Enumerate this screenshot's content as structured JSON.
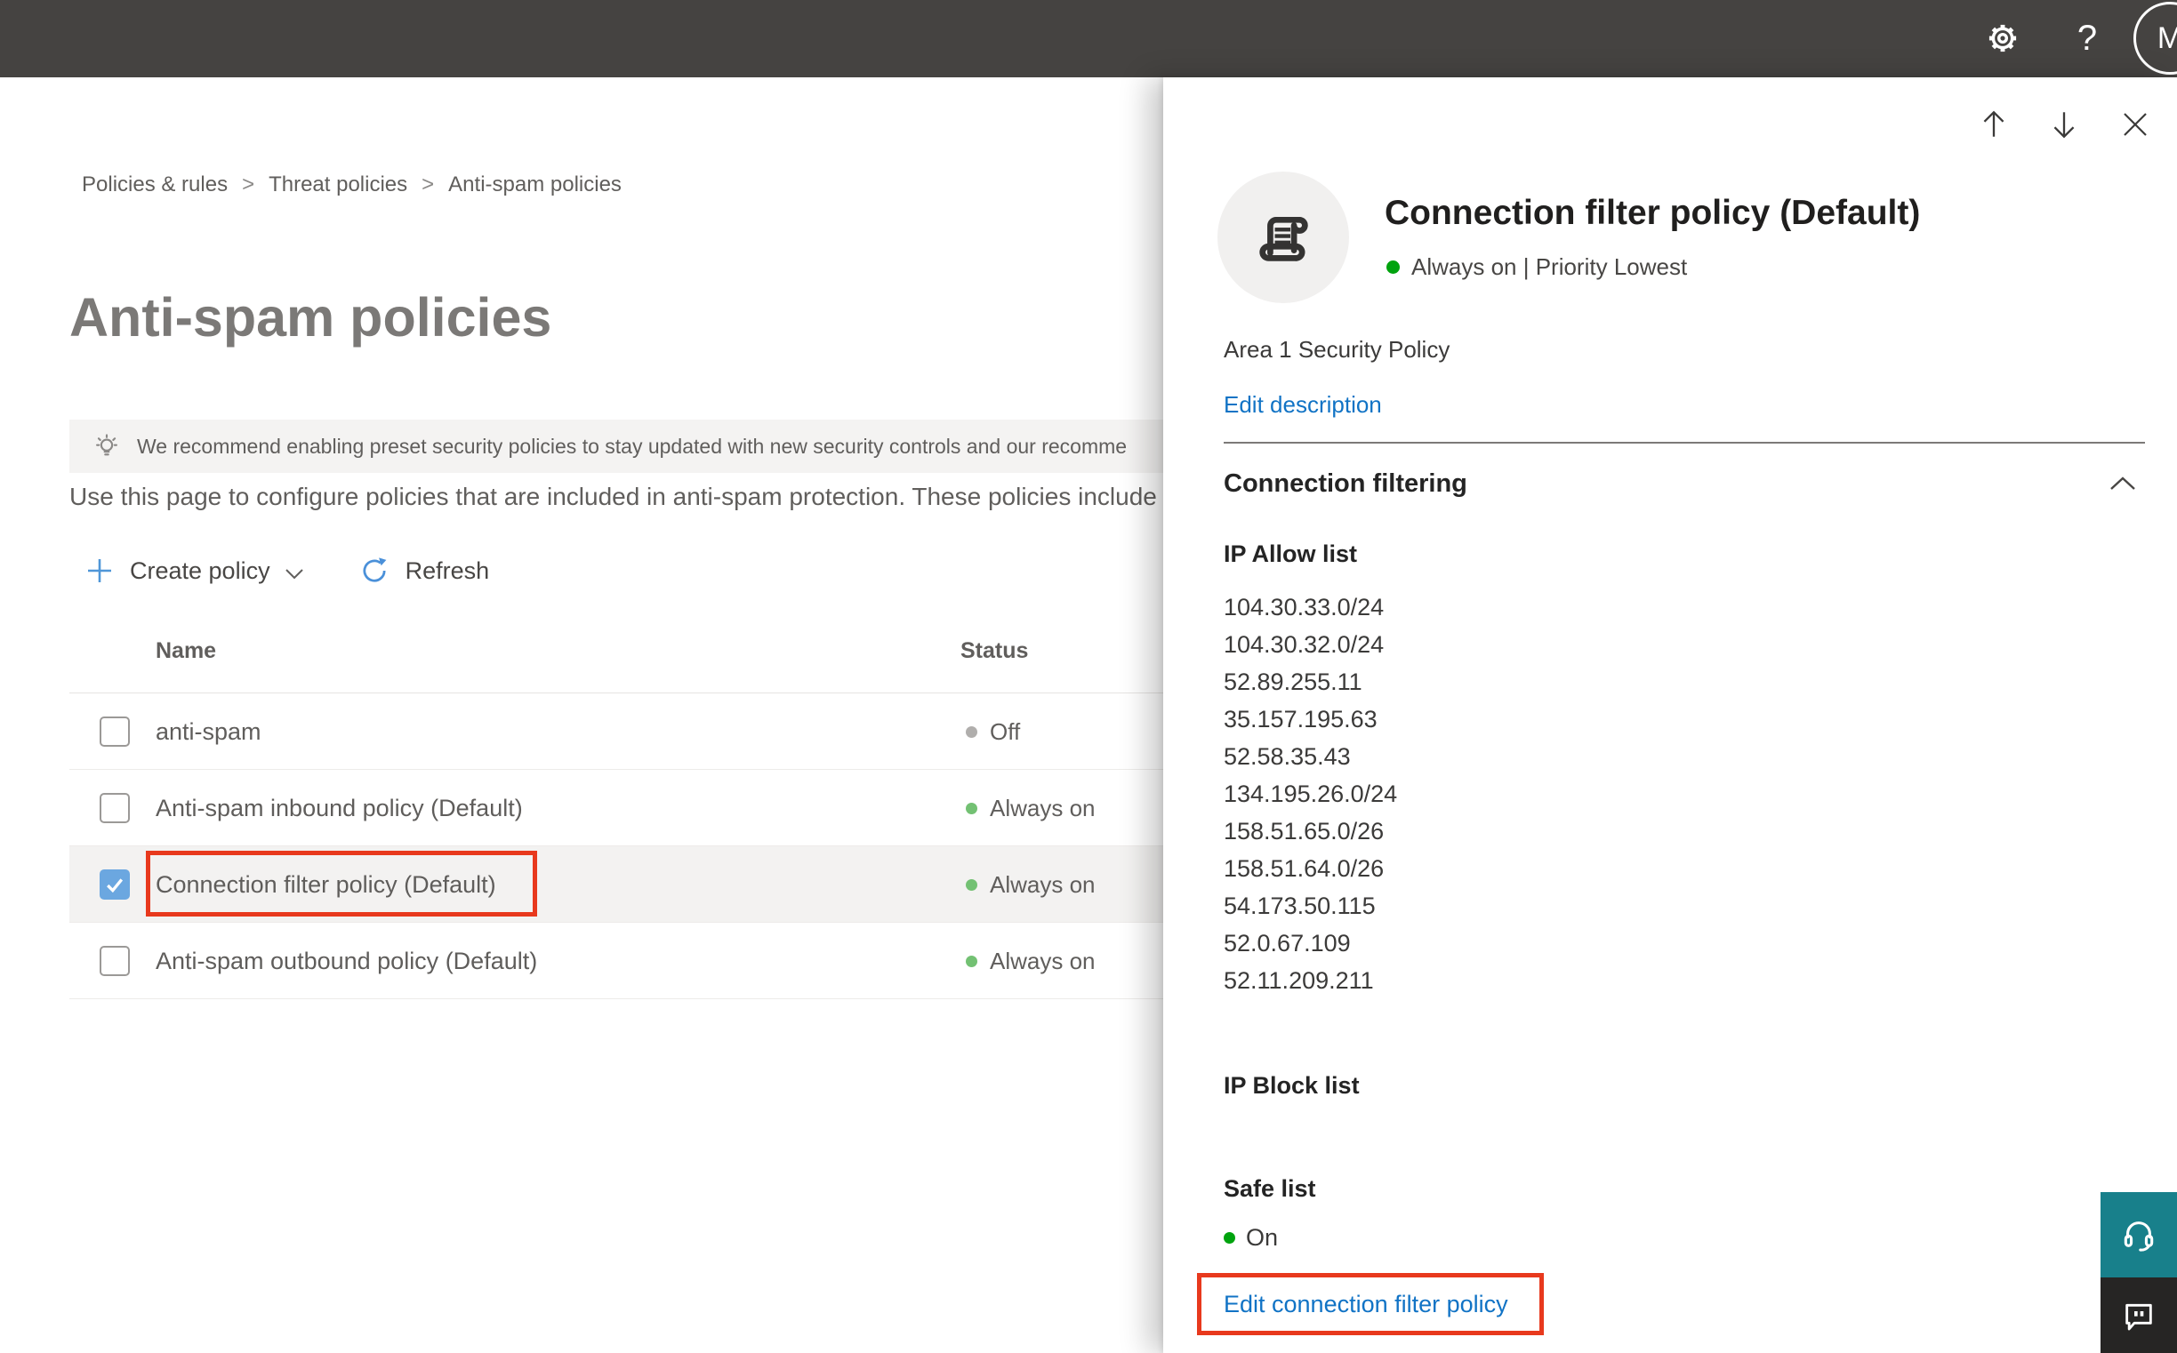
{
  "topbar": {
    "icons": [
      "gear-icon",
      "help-icon",
      "avatar"
    ],
    "help_glyph": "?",
    "avatar_initial": "M"
  },
  "breadcrumb": {
    "items": [
      "Policies & rules",
      "Threat policies",
      "Anti-spam policies"
    ],
    "separator": ">"
  },
  "page": {
    "title": "Anti-spam policies",
    "banner_text": "We recommend enabling preset security policies to stay updated with new security controls and our recomme",
    "description": "Use this page to configure policies that are included in anti-spam protection. These policies include"
  },
  "toolbar": {
    "create_label": "Create policy",
    "refresh_label": "Refresh"
  },
  "table": {
    "columns": [
      "Name",
      "Status"
    ],
    "rows": [
      {
        "name": "anti-spam",
        "status": "Off",
        "state": "off",
        "checked": false,
        "annotated": false
      },
      {
        "name": "Anti-spam inbound policy (Default)",
        "status": "Always on",
        "state": "on",
        "checked": false,
        "annotated": false
      },
      {
        "name": "Connection filter policy (Default)",
        "status": "Always on",
        "state": "on",
        "checked": true,
        "annotated": true
      },
      {
        "name": "Anti-spam outbound policy (Default)",
        "status": "Always on",
        "state": "on",
        "checked": false,
        "annotated": false
      }
    ]
  },
  "flyout": {
    "nav_icons": [
      "arrow-up-icon",
      "arrow-down-icon",
      "close-icon"
    ],
    "header_icon": "scroll-policy-icon",
    "title": "Connection filter policy (Default)",
    "status_line": "Always on | Priority Lowest",
    "description": "Area 1 Security Policy",
    "edit_description_label": "Edit description",
    "section_title": "Connection filtering",
    "ip_allow_title": "IP Allow list",
    "ip_allow_list": [
      "104.30.33.0/24",
      "104.30.32.0/24",
      "52.89.255.11",
      "35.157.195.63",
      "52.58.35.43",
      "134.195.26.0/24",
      "158.51.65.0/26",
      "158.51.64.0/26",
      "54.173.50.115",
      "52.0.67.109",
      "52.11.209.211"
    ],
    "ip_block_title": "IP Block list",
    "safe_list_title": "Safe list",
    "safe_list_status": "On",
    "edit_link_label": "Edit connection filter policy"
  },
  "corner_buttons": {
    "icons": [
      "headset-icon",
      "feedback-bubble-icon"
    ]
  },
  "colors": {
    "topbar_bg": "#454341",
    "accent_link": "#1173c5",
    "checkbox_checked": "#6ba7e0",
    "annotation_red": "#e8391d",
    "status_on_green": "#73c173",
    "status_off_gray": "#b0aeac",
    "flyout_green": "#00a30e",
    "support_teal": "#18808b",
    "feedback_dark": "#262524"
  }
}
